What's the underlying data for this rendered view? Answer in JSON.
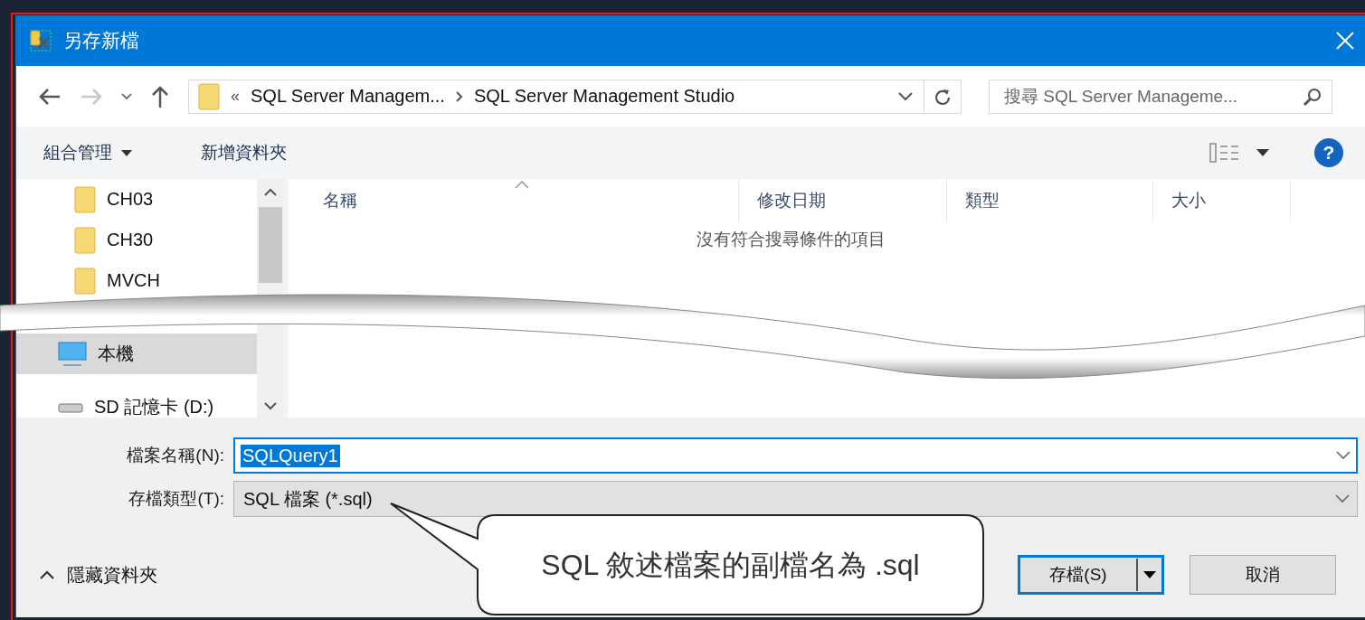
{
  "window": {
    "title": "另存新檔"
  },
  "address_bar": {
    "overflow": "«",
    "breadcrumbs": [
      "SQL Server Managem...",
      "SQL Server Management Studio"
    ]
  },
  "search": {
    "placeholder": "搜尋 SQL Server Manageme..."
  },
  "toolbar": {
    "items": [
      {
        "label": "組合管理",
        "dropdown": true
      },
      {
        "label": "新增資料夾",
        "dropdown": false
      }
    ],
    "help": "?"
  },
  "nav_pane": {
    "items": [
      {
        "label": "CH03",
        "kind": "folder",
        "selected": false
      },
      {
        "label": "CH30",
        "kind": "folder",
        "selected": false
      },
      {
        "label": "MVCH",
        "kind": "folder",
        "selected": false
      },
      {
        "label": "本機",
        "kind": "computer",
        "selected": true
      },
      {
        "label": "SD 記憶卡 (D:)",
        "kind": "drive",
        "selected": false
      }
    ]
  },
  "file_list": {
    "columns": [
      {
        "label": "名稱",
        "sorted": true
      },
      {
        "label": "修改日期",
        "sorted": false
      },
      {
        "label": "類型",
        "sorted": false
      },
      {
        "label": "大小",
        "sorted": false
      }
    ],
    "empty_message": "沒有符合搜尋條件的項目"
  },
  "file_name": {
    "label": "檔案名稱(N):",
    "value": "SQLQuery1",
    "text_selected": true
  },
  "file_type": {
    "label": "存檔類型(T):",
    "value": "SQL 檔案 (*.sql)"
  },
  "hide_folders": "隱藏資料夾",
  "buttons": [
    {
      "label": "存檔(S)",
      "default": true,
      "split": true
    },
    {
      "label": "取消",
      "default": false,
      "split": false
    }
  ],
  "callout": {
    "text": "SQL 敘述檔案的副檔名為 .sql"
  }
}
